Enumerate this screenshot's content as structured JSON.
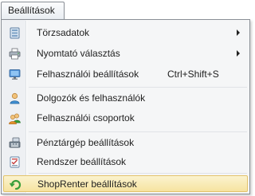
{
  "menubar": {
    "title": "Beállítások"
  },
  "menu": {
    "items": [
      {
        "label": "Törzsadatok",
        "shortcut": "",
        "has_submenu": true,
        "icon": "database-icon"
      },
      {
        "label": "Nyomtató választás",
        "shortcut": "",
        "has_submenu": true,
        "icon": "printer-icon"
      },
      {
        "label": "Felhasználói beállítások",
        "shortcut": "Ctrl+Shift+S",
        "has_submenu": false,
        "icon": "monitor-icon"
      },
      {
        "label": "Dolgozók és felhasználók",
        "shortcut": "",
        "has_submenu": false,
        "icon": "user-icon"
      },
      {
        "label": "Felhasználói csoportok",
        "shortcut": "",
        "has_submenu": false,
        "icon": "users-group-icon"
      },
      {
        "label": "Pénztárgép beállítások",
        "shortcut": "",
        "has_submenu": false,
        "icon": "cash-register-icon"
      },
      {
        "label": "Rendszer beállítások",
        "shortcut": "",
        "has_submenu": false,
        "icon": "checklist-icon"
      },
      {
        "label": "ShopRenter beállítások",
        "shortcut": "",
        "has_submenu": false,
        "icon": "shoprenter-icon",
        "selected": true
      }
    ]
  },
  "colors": {
    "highlight_top": "#fbf3cf",
    "highlight_bottom": "#f6e3a0",
    "highlight_border": "#e3c36a",
    "menu_background": "#f5f6f7"
  }
}
